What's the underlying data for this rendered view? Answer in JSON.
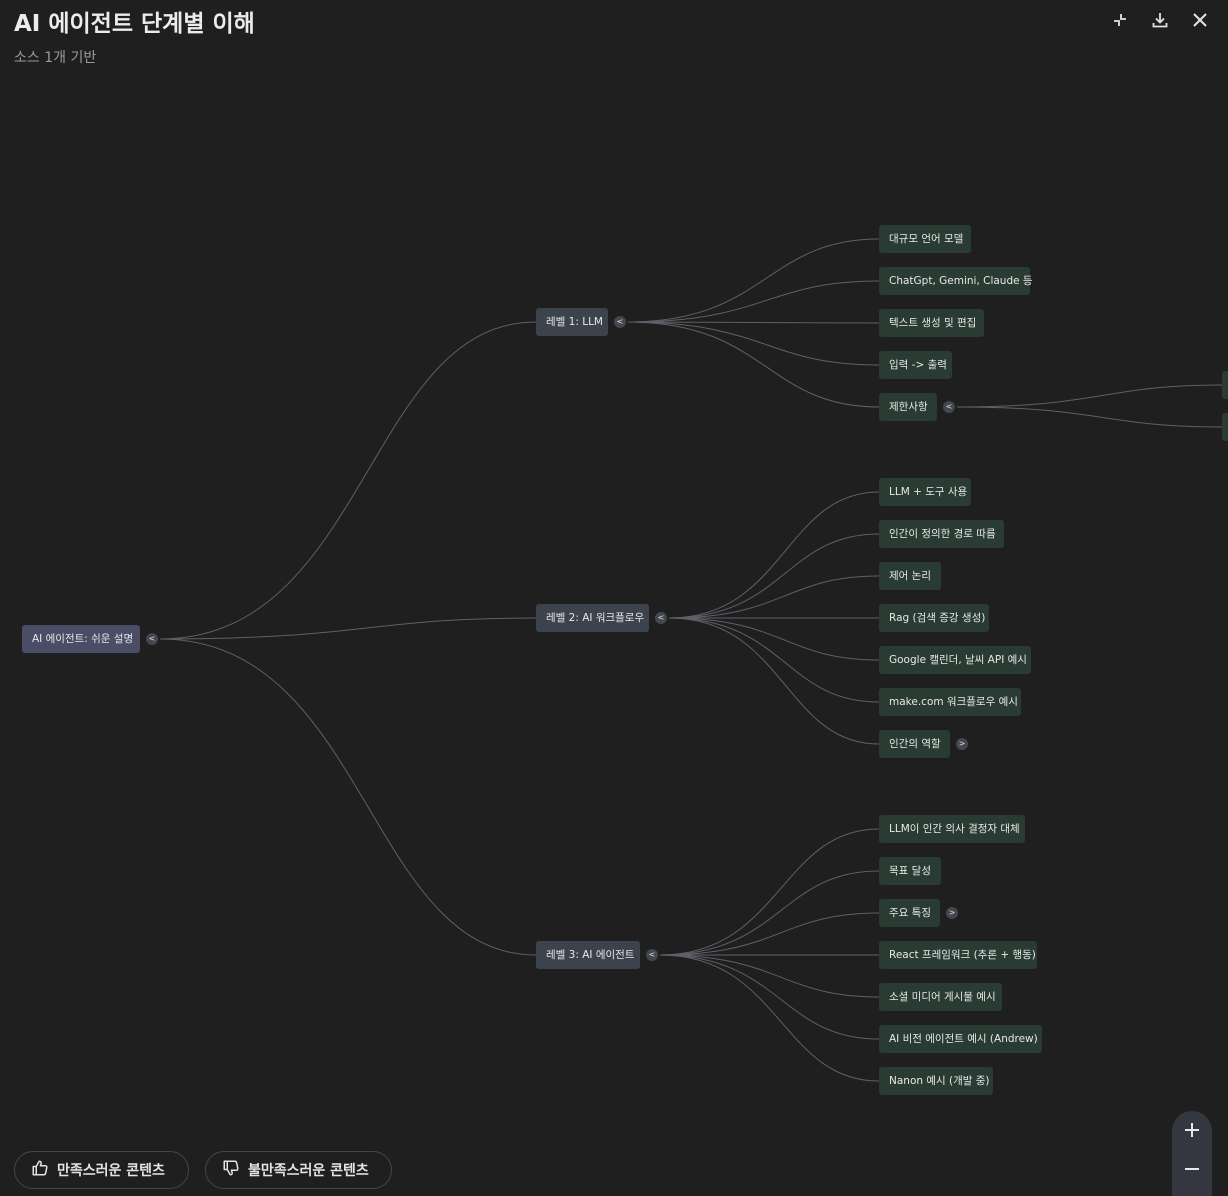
{
  "header": {
    "title": "AI 에이전트 단계별 이해",
    "subtitle": "소스 1개 기반",
    "actions": [
      "collapse-icon",
      "download-icon",
      "close-icon"
    ]
  },
  "mindmap": {
    "root": {
      "label": "AI 에이전트: 쉬운 설명",
      "toggle": "<"
    },
    "levels": [
      {
        "label": "레벨 1: LLM",
        "toggle": "<",
        "children": [
          {
            "label": "대규모 언어 모델"
          },
          {
            "label": "ChatGpt, Gemini, Claude 등"
          },
          {
            "label": "텍스트 생성 및 편집"
          },
          {
            "label": "입력 -> 출력"
          },
          {
            "label": "제한사항",
            "toggle": "<"
          }
        ]
      },
      {
        "label": "레벨 2: AI 워크플로우",
        "toggle": "<",
        "children": [
          {
            "label": "LLM + 도구 사용"
          },
          {
            "label": "인간이 정의한 경로 따름"
          },
          {
            "label": "제어 논리"
          },
          {
            "label": "Rag (검색 증강 생성)"
          },
          {
            "label": "Google 캘린더, 날씨 API 예시"
          },
          {
            "label": "make.com 워크플로우 예시"
          },
          {
            "label": "인간의 역할",
            "toggle": ">"
          }
        ]
      },
      {
        "label": "레벨 3: AI 에이전트",
        "toggle": "<",
        "children": [
          {
            "label": "LLM이 인간 의사 결정자 대체"
          },
          {
            "label": "목표 달성"
          },
          {
            "label": "주요 특징",
            "toggle": ">"
          },
          {
            "label": "React 프레임워크 (추론 + 행동)"
          },
          {
            "label": "소셜 미디어 게시물 예시"
          },
          {
            "label": "AI 비전 에이전트 예시 (Andrew)"
          },
          {
            "label": "Nanon 예시 (개발 중)"
          }
        ]
      }
    ],
    "colors": {
      "background": "#1f1f1f",
      "root_node": "#4a4d66",
      "level_node": "#3d434c",
      "leaf_node": "#2a3b33",
      "edge": "#5f6169"
    }
  },
  "feedback": {
    "positive_label": "만족스러운 콘텐츠",
    "negative_label": "불만족스러운 콘텐츠"
  },
  "zoom": {
    "in_icon": "plus-icon",
    "out_icon": "minus-icon"
  }
}
